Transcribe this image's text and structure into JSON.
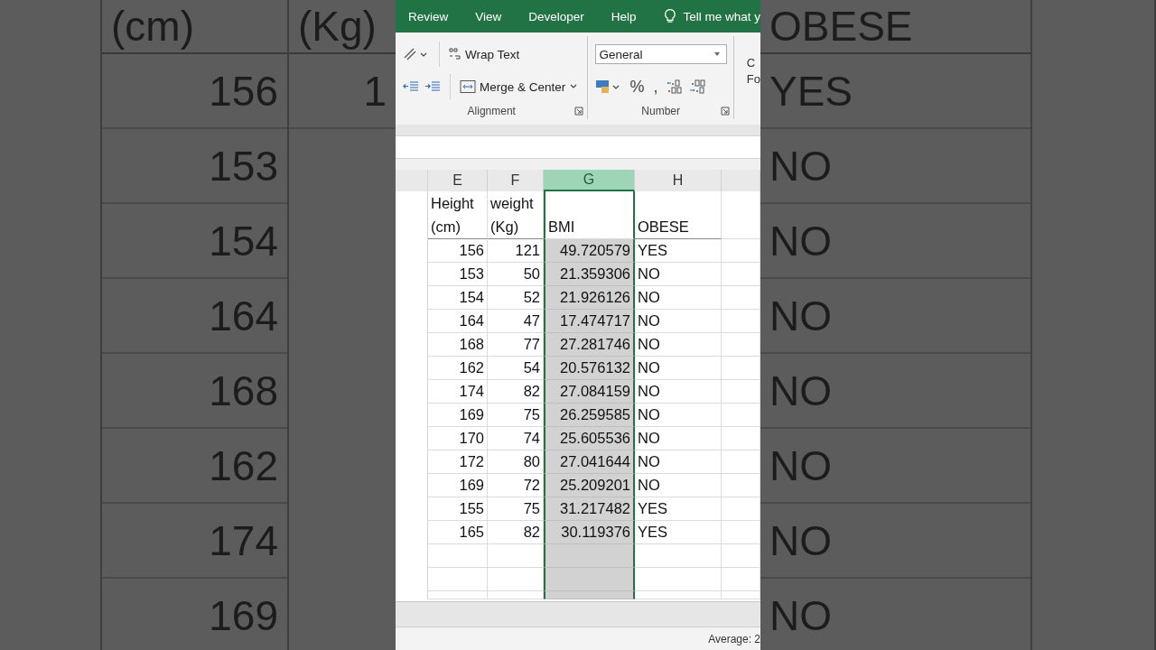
{
  "backdrop_left": {
    "columns": [
      {
        "header": "(cm)",
        "values": [
          "156",
          "153",
          "154",
          "164",
          "168",
          "162",
          "174",
          "169"
        ]
      },
      {
        "header": "(Kg)",
        "values": [
          "1"
        ]
      }
    ]
  },
  "ribbon": {
    "tabs": [
      "Review",
      "View",
      "Developer",
      "Help"
    ],
    "tell_me": "Tell me what y",
    "alignment": {
      "wrap_text": "Wrap Text",
      "merge": "Merge & Center",
      "label": "Alignment"
    },
    "number": {
      "format": "General",
      "symbols": [
        "%",
        ","
      ],
      "label": "Number"
    },
    "cut_button": [
      "C",
      "Fo"
    ]
  },
  "sheet": {
    "columns": [
      {
        "label": "E",
        "selected": false,
        "kind": "number"
      },
      {
        "label": "F",
        "selected": false,
        "kind": "number"
      },
      {
        "label": "G",
        "selected": true,
        "kind": "number"
      },
      {
        "label": "H",
        "selected": false,
        "kind": "text"
      }
    ],
    "header_row": [
      "Height (cm)",
      "weight (Kg)",
      "BMI",
      "OBESE"
    ],
    "rows": [
      [
        "156",
        "121",
        "49.720579",
        "YES"
      ],
      [
        "153",
        "50",
        "21.359306",
        "NO"
      ],
      [
        "154",
        "52",
        "21.926126",
        "NO"
      ],
      [
        "164",
        "47",
        "17.474717",
        "NO"
      ],
      [
        "168",
        "77",
        "27.281746",
        "NO"
      ],
      [
        "162",
        "54",
        "20.576132",
        "NO"
      ],
      [
        "174",
        "82",
        "27.084159",
        "NO"
      ],
      [
        "169",
        "75",
        "26.259585",
        "NO"
      ],
      [
        "170",
        "74",
        "25.605536",
        "NO"
      ],
      [
        "172",
        "80",
        "27.041644",
        "NO"
      ],
      [
        "169",
        "72",
        "25.209201",
        "NO"
      ],
      [
        "155",
        "75",
        "31.217482",
        "YES"
      ],
      [
        "165",
        "82",
        "30.119376",
        "YES"
      ]
    ]
  },
  "status_bar": {
    "summary": "Average: 2"
  },
  "backdrop_right": {
    "header": "OBESE",
    "values": [
      "YES",
      "NO",
      "NO",
      "NO",
      "NO",
      "NO",
      "NO",
      "NO"
    ]
  }
}
